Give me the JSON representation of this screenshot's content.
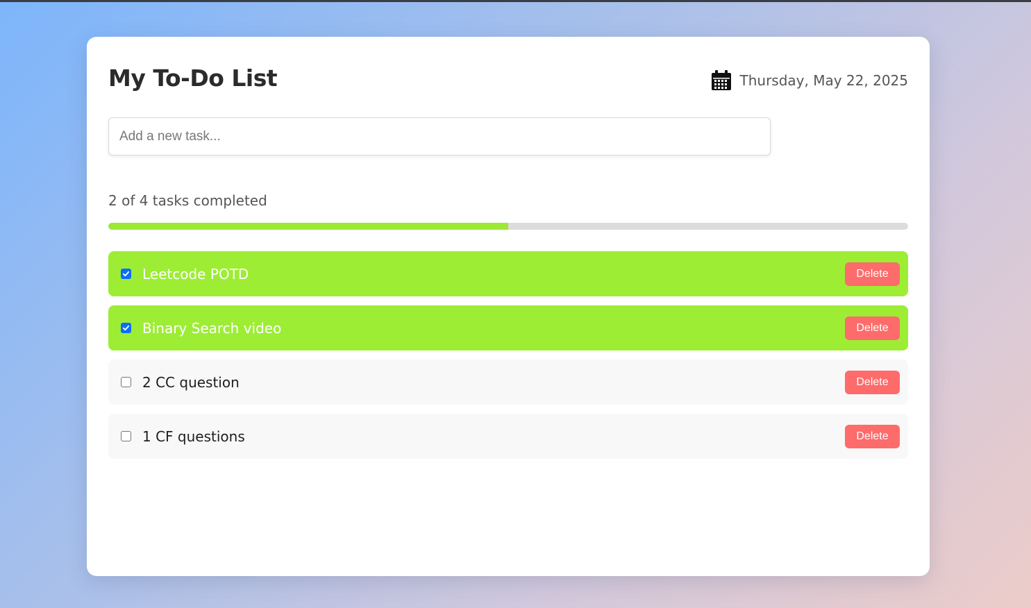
{
  "header": {
    "title": "My To-Do List",
    "date": "Thursday, May 22, 2025",
    "date_icon": "calendar-icon"
  },
  "input": {
    "placeholder": "Add a new task...",
    "value": ""
  },
  "progress": {
    "label": "2 of 4 tasks completed",
    "completed": 2,
    "total": 4,
    "fraction": 0.5,
    "fill_color": "#9de835"
  },
  "tasks": [
    {
      "text": "Leetcode POTD",
      "done": true,
      "delete_label": "Delete"
    },
    {
      "text": "Binary Search video",
      "done": true,
      "delete_label": "Delete"
    },
    {
      "text": "2 CC question",
      "done": false,
      "delete_label": "Delete"
    },
    {
      "text": "1 CF questions",
      "done": false,
      "delete_label": "Delete"
    }
  ],
  "colors": {
    "done_bg": "#9ded35",
    "pending_bg": "#f8f8f8",
    "delete_bg": "#fd6b6b",
    "checkbox_accent": "#0b6dfa"
  }
}
